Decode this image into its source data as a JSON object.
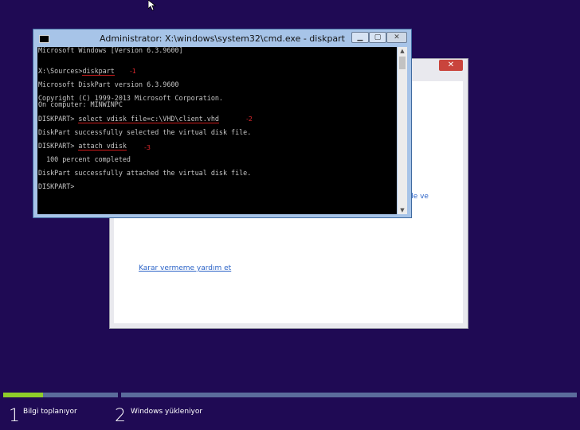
{
  "cmd_window": {
    "title": "Administrator: X:\\windows\\system32\\cmd.exe - diskpart",
    "lines": [
      "Microsoft Windows [Version 6.3.9600]",
      "X:\\Sources>",
      "diskpart",
      "Microsoft DiskPart version 6.3.9600",
      "Copyright (C) 1999-2013 Microsoft Corporation.",
      "On computer: MINWINPC",
      "DISKPART> ",
      "select vdisk file=c:\\VHD\\client.vhd",
      "DiskPart successfully selected the virtual disk file.",
      "DISKPART> ",
      "attach vdisk",
      "  100 percent completed",
      "DiskPart successfully attached the virtual disk file.",
      "DISKPART>"
    ],
    "annotations": [
      "-1",
      "-2",
      "-3"
    ],
    "annotation_color": "#e0282d"
  },
  "setup_dialog": {
    "link_partial": "de ve",
    "help_link": "Karar vermeme yardım et",
    "close_icon": "close-icon"
  },
  "progress": {
    "step1_number": "1",
    "step1_label": "Bilgi toplanıyor",
    "step2_number": "2",
    "step2_label": "Windows yükleniyor",
    "step1_fill_fraction": 0.35,
    "fill_color": "#8fcd2a"
  }
}
